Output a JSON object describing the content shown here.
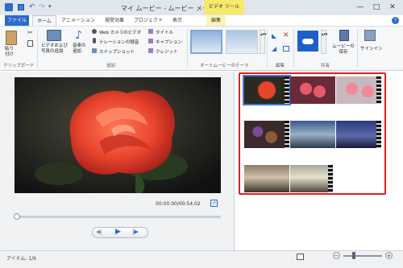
{
  "window": {
    "title": "マイ ムービー - ムービー メーカー",
    "contextual_tab": "ビデオ ツール",
    "minimize_glyph": "—",
    "maximize_glyph": "□",
    "close_glyph": "✕"
  },
  "tabs": [
    "ファイル",
    "ホーム",
    "アニメーション",
    "視覚効果",
    "プロジェクト",
    "表示",
    "編集"
  ],
  "ribbon": {
    "clipboard": {
      "paste": "貼り付け",
      "group": "クリップボード"
    },
    "add": {
      "add_video_photo": "ビデオおよび写真の追加",
      "add_music": "音楽の追加",
      "webcam_video": "Web カメラのビデオ",
      "record_narration": "ナレーションの録音",
      "snapshot": "スナップショット",
      "title": "タイトル",
      "caption": "キャプション",
      "credits": "クレジット",
      "group": "追加"
    },
    "themes": {
      "group": "オートムービーのテーマ"
    },
    "editing": {
      "group": "編集"
    },
    "share": {
      "save_movie": "ムービーの保存",
      "group": "共有"
    },
    "signin": {
      "label": "サインイン"
    }
  },
  "player": {
    "time": "00:00.00/00:54.02",
    "seek_progress": 0.0
  },
  "status": {
    "items": "アイテム: 1/6"
  },
  "colors": {
    "accent": "#2d6ac9",
    "highlight_frame": "#e02020",
    "contextual": "#f7e96a"
  }
}
